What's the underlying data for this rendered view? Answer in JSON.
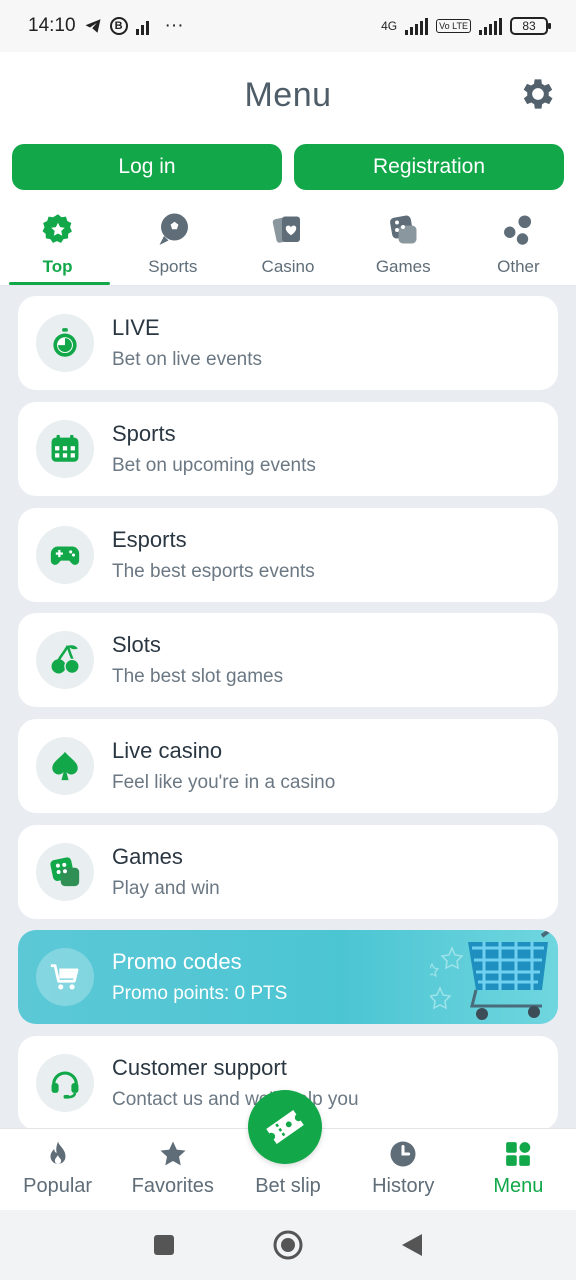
{
  "status_bar": {
    "time": "14:10",
    "battery": "83",
    "network": "4G",
    "volte": "Vo LTE",
    "more": "···",
    "b_badge": "B"
  },
  "header": {
    "title": "Menu"
  },
  "auth": {
    "login_label": "Log in",
    "register_label": "Registration"
  },
  "tabs": [
    {
      "label": "Top",
      "icon": "star-badge-icon",
      "active": true
    },
    {
      "label": "Sports",
      "icon": "soccer-ball-icon"
    },
    {
      "label": "Casino",
      "icon": "playing-cards-icon"
    },
    {
      "label": "Games",
      "icon": "dice-icon"
    },
    {
      "label": "Other",
      "icon": "dots-icon"
    }
  ],
  "items": [
    {
      "title": "LIVE",
      "subtitle": "Bet on live events",
      "icon": "stopwatch-icon"
    },
    {
      "title": "Sports",
      "subtitle": "Bet on upcoming events",
      "icon": "calendar-icon"
    },
    {
      "title": "Esports",
      "subtitle": "The best esports events",
      "icon": "gamepad-icon"
    },
    {
      "title": "Slots",
      "subtitle": "The best slot games",
      "icon": "cherries-icon"
    },
    {
      "title": "Live casino",
      "subtitle": "Feel like you're in a casino",
      "icon": "spade-icon"
    },
    {
      "title": "Games",
      "subtitle": "Play and win",
      "icon": "dice-icon"
    },
    {
      "title": "Promo codes",
      "subtitle": "Promo points: 0 PTS",
      "icon": "cart-icon"
    },
    {
      "title": "Customer support",
      "subtitle": "Contact us and we'll help you",
      "icon": "headset-icon"
    }
  ],
  "bottom_nav": [
    {
      "label": "Popular",
      "icon": "flame-icon"
    },
    {
      "label": "Favorites",
      "icon": "star-icon"
    },
    {
      "label": "Bet slip",
      "icon": "ticket-icon"
    },
    {
      "label": "History",
      "icon": "clock-icon"
    },
    {
      "label": "Menu",
      "icon": "grid-icon",
      "active": true
    }
  ],
  "colors": {
    "accent": "#12a84a",
    "text_muted": "#6b7883",
    "list_bg": "#e9edf2",
    "promo": "#4cc5d3"
  }
}
